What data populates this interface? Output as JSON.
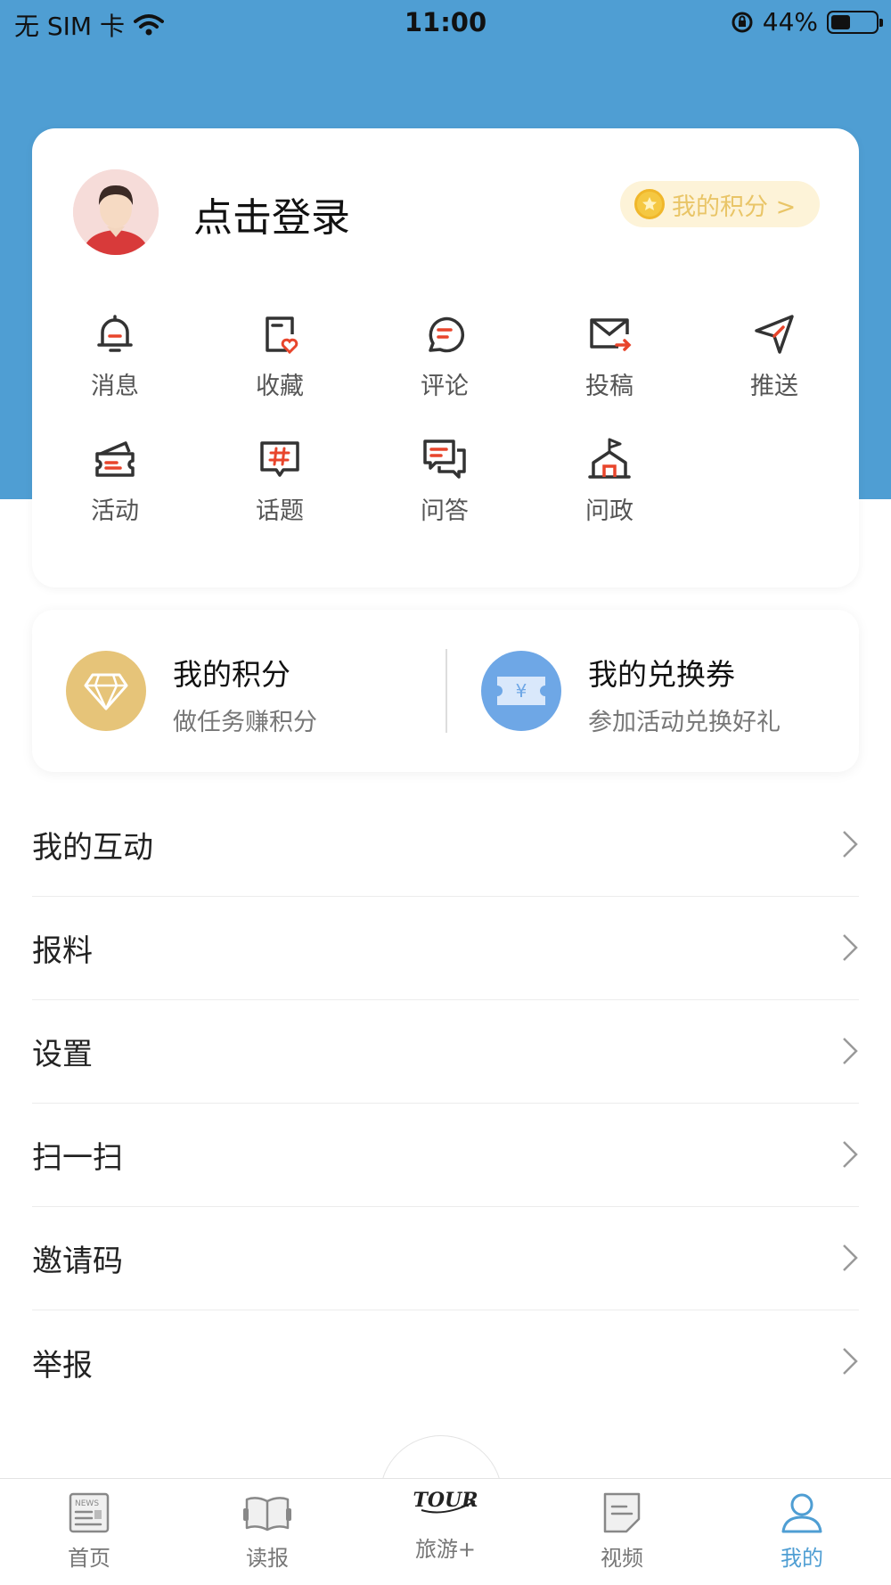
{
  "status_bar": {
    "carrier": "无 SIM 卡",
    "time": "11:00",
    "battery": "44%",
    "battery_level": 0.44
  },
  "profile": {
    "login_text": "点击登录",
    "points_button": "我的积分 >"
  },
  "grid": [
    {
      "label": "消息",
      "icon": "bell-icon"
    },
    {
      "label": "收藏",
      "icon": "bookmark-heart-icon"
    },
    {
      "label": "评论",
      "icon": "comment-icon"
    },
    {
      "label": "投稿",
      "icon": "mail-send-icon"
    },
    {
      "label": "推送",
      "icon": "send-icon"
    },
    {
      "label": "活动",
      "icon": "ticket-icon"
    },
    {
      "label": "话题",
      "icon": "hashtag-icon"
    },
    {
      "label": "问答",
      "icon": "qa-icon"
    },
    {
      "label": "问政",
      "icon": "government-icon"
    }
  ],
  "points_card": {
    "points": {
      "title": "我的积分",
      "subtitle": "做任务赚积分",
      "color": "#e6c479"
    },
    "coupons": {
      "title": "我的兑换券",
      "subtitle": "参加活动兑换好礼",
      "color": "#6ea7e6",
      "glyph": "¥"
    }
  },
  "menu": [
    "我的互动",
    "报料",
    "设置",
    "扫一扫",
    "邀请码",
    "举报"
  ],
  "tabs": [
    {
      "label": "首页",
      "icon": "newspaper-icon",
      "active": false
    },
    {
      "label": "读报",
      "icon": "open-book-icon",
      "active": false
    },
    {
      "label": "旅游+",
      "icon": "tour-logo-icon",
      "logo_text": "TOUR",
      "active": false
    },
    {
      "label": "视频",
      "icon": "video-doc-icon",
      "active": false
    },
    {
      "label": "我的",
      "icon": "user-icon",
      "active": true
    }
  ],
  "colors": {
    "accent": "#4f9ed3",
    "icon_red": "#e8452c",
    "icon_dark": "#333333"
  }
}
